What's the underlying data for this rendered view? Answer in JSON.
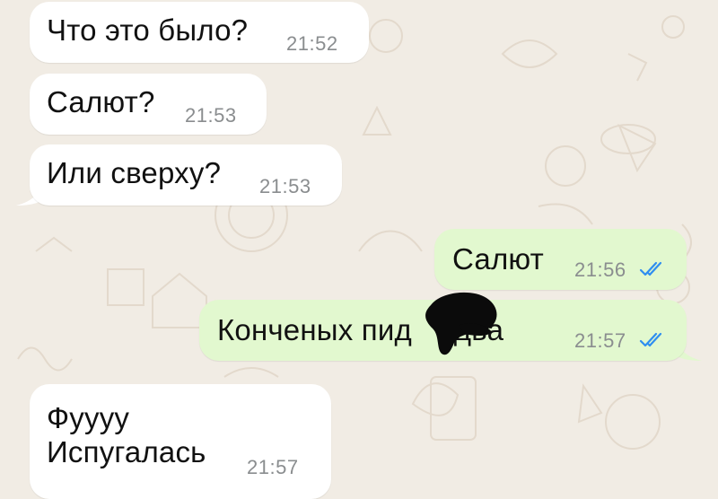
{
  "chat": {
    "messages": [
      {
        "direction": "incoming",
        "text": "Что это было?",
        "time": "21:52"
      },
      {
        "direction": "incoming",
        "text": "Салют?",
        "time": "21:53"
      },
      {
        "direction": "incoming",
        "text": "Или сверху?",
        "time": "21:53"
      },
      {
        "direction": "outgoing",
        "text": "Салют",
        "time": "21:56",
        "status": "read"
      },
      {
        "direction": "outgoing",
        "text": "Конченых пид     два",
        "time": "21:57",
        "status": "read",
        "redacted": true
      },
      {
        "direction": "incoming",
        "lines": [
          "Фуууу",
          "Испугалась"
        ],
        "time": "21:57"
      }
    ]
  },
  "colors": {
    "incoming_bubble": "#ffffff",
    "outgoing_bubble": "#e2f8cf",
    "wallpaper": "#f1ece4",
    "read_ticks": "#2f8ef0",
    "time": "#8a8d8f"
  },
  "icons": {
    "read_receipt": "double-check-icon",
    "redaction": "black-scribble"
  }
}
